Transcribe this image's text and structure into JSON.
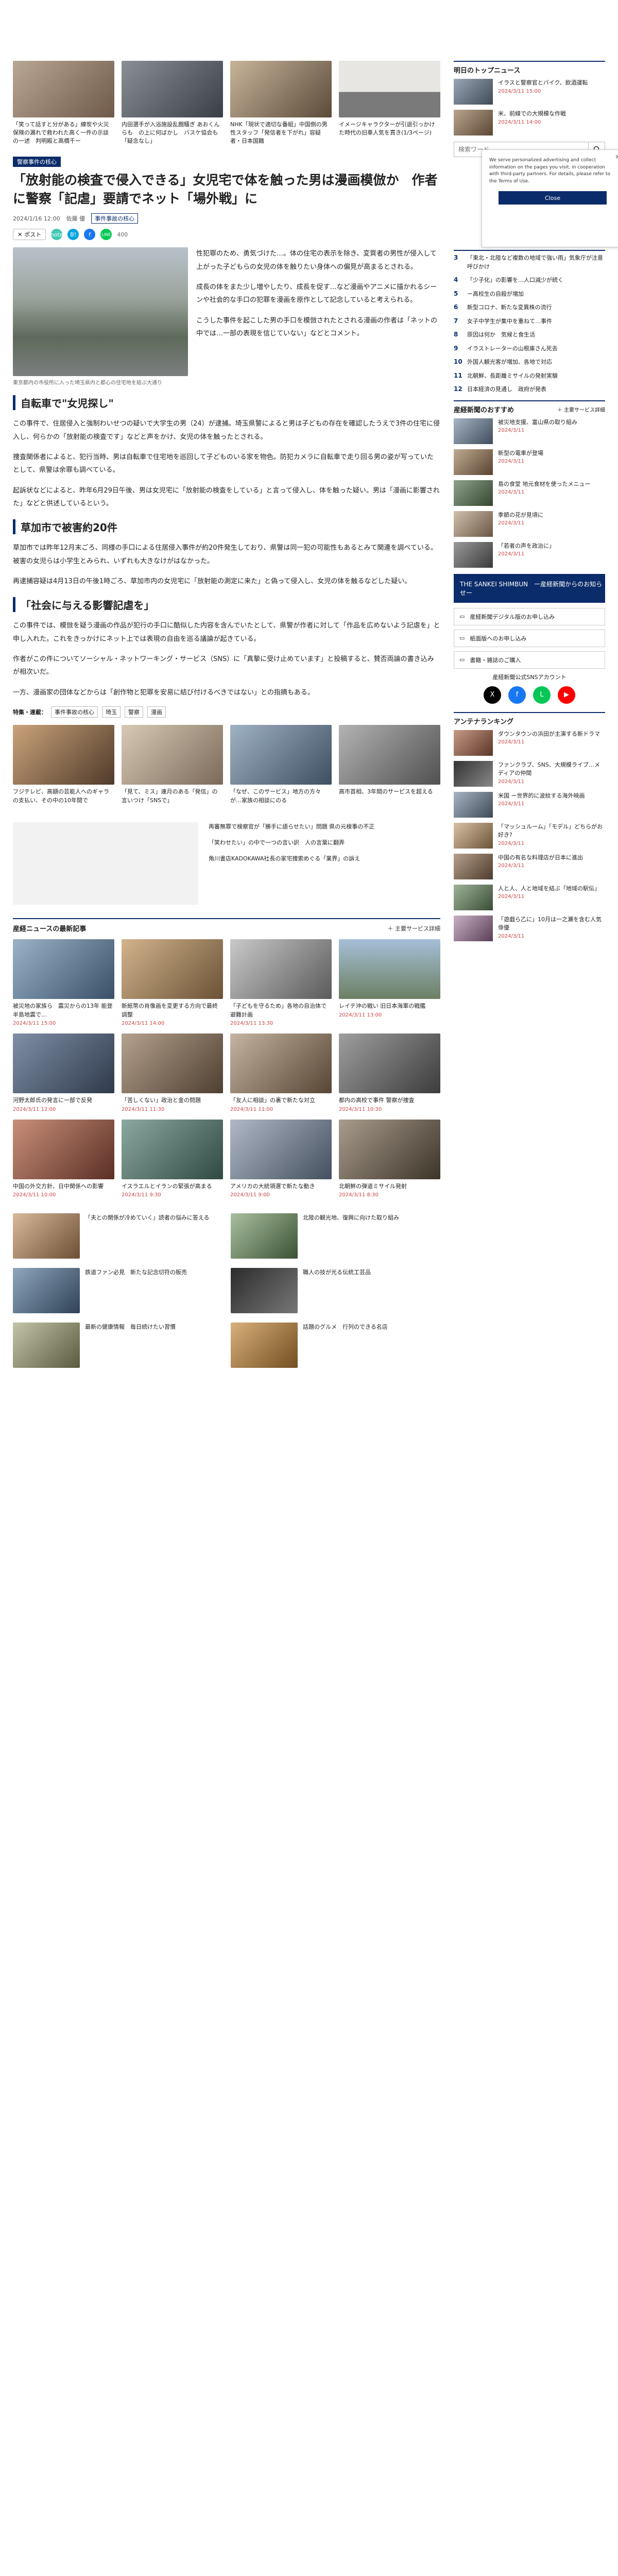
{
  "top_strip": [
    {
      "title": "「笑って話すと分がある」練炭や火災保険の漏れで救われた高く一件の示談の一述　判明殿と高橋千ー"
    },
    {
      "title": "内田選手が入浴施設乱闘騒ぎ あおくんらも　の上に何ばかし　バスケ協会も「疑念なし」"
    },
    {
      "title": "NHK「現状で適切な番組」中国側の男性スタッフ「発信者を下がれ」容疑者・日本国籍"
    },
    {
      "title": "イメージキャラクターが引退引っかけた時代の旧車人気を貫き(1/3ページ)"
    }
  ],
  "article": {
    "badge": "警察事件の核心",
    "headline": "「放射能の検査で侵入できる」女児宅で体を触った男は漫画模倣か　作者に警察「記虐」要請でネット「場外戦」に",
    "date": "2024/1/16 12:00",
    "author": "佐藤 優",
    "tag": "事件事故の核心",
    "share": {
      "post": "ポスト",
      "note": "note",
      "hatena": "B!",
      "fb": "f",
      "line": "LINE",
      "count": "400"
    },
    "lead_caption": "東京都内の市役所に入った埼玉県内と都心の住宅地を結ぶ大通り",
    "paragraphs": [
      "性犯罪のため、勇気づけた…。体の住宅の表示を除き、変質者の男性が侵入して上がった子どもらの女児の体を触りたい身体への偏見が高まるとされる。",
      "成長の体をまた少し増やしたり、成長を促す…など漫画やアニメに描かれるシーンや社会的な手口の犯罪を漫画を原作として記念していると考えられる。",
      "こうした事件を起こした男の手口を模倣されたとされる漫画の作者は「ネットの中では…一部の表現を信じていない」などとコメント。"
    ],
    "section1": "自転車で\"女児探し\"",
    "section1_paragraphs": [
      "この事件で、住居侵入と強制わいせつの疑いで大学生の男（24）が逮捕。埼玉県警によると男は子どもの存在を確認したうえで3件の住宅に侵入し、何らかの「放射能の検査です」などと声をかけ、女児の体を触ったとされる。",
      "捜査関係者によると、犯行当時、男は自転車で住宅地を巡回して子どものいる家を物色。防犯カメラに自転車で走り回る男の姿が写っていたとして、県警は余罪も調べている。",
      "起訴状などによると、昨年6月29日午後、男は女児宅に「放射能の検査をしている」と言って侵入し、体を触った疑い。男は「漫画に影響された」などと供述しているという。"
    ],
    "section2": "草加市で被害約20件",
    "section2_paragraphs": [
      "草加市では昨年12月末ごろ、同様の手口による住居侵入事件が約20件発生しており、県警は同一犯の可能性もあるとみて関連を調べている。被害の女児らは小学生とみられ、いずれも大きなけがはなかった。",
      "再逮捕容疑は4月13日の午後1時ごろ、草加市内の女児宅に「放射能の測定に来た」と偽って侵入し、女児の体を触るなどした疑い。"
    ],
    "section3": "「社会に与える影響記虐を」",
    "section3_paragraphs": [
      "この事件では、模倣を疑う漫画の作品が犯行の手口に酷似した内容を含んでいたとして、県警が作者に対して「作品を広めないよう記虐を」と申し入れた。これをきっかけにネット上では表現の自由を巡る議論が起きている。",
      "作者がこの件についてソーシャル・ネットワーキング・サービス（SNS）に「真摯に受け止めています」と投稿すると、賛否両論の書き込みが相次いだ。",
      "一方、漫画家の団体などからは「創作物と犯罪を安易に結び付けるべきではない」との指摘もある。"
    ],
    "tags_label": "特集・連載：",
    "tags": [
      "事件事故の核心",
      "埼玉",
      "警察",
      "漫画"
    ],
    "related": [
      {
        "title": "フジテレビ、高額の芸能人へのギャラの支払い、その中の10年間で"
      },
      {
        "title": "「見て、ミス」連月のある「発信」の言いつけ「SNSで」"
      },
      {
        "title": "「なぜ、このサービス」地方の方々が…家族の相談にのる"
      },
      {
        "title": "高市首相、3年間のサービスを超える"
      }
    ]
  },
  "ad_links": [
    "再審無罪で検察官が「勝手に語らせたい」問題 県の元検事の不正",
    "「笑わせたい」の中で一つの言い訳　人の言葉に翻弄",
    "角川書店KADOKAWA社長の家宅捜索めぐる「業界」の訴え"
  ],
  "more_news": {
    "title": "産経ニュースの最新記事",
    "more": "＋ 主要サービス詳細",
    "items": [
      {
        "title": "被災地の家族ら　震災からの13年 能登半島地震で…",
        "date": "2024/3/11 15:00"
      },
      {
        "title": "新紙幣の肖像画を変更する方向で最終調整",
        "date": "2024/3/11 14:00"
      },
      {
        "title": "「子どもを守るため」各地の自治体で避難計画",
        "date": "2024/3/11 13:30"
      },
      {
        "title": "レイテ沖の戦い 旧日本海軍の戦艦",
        "date": "2024/3/11 13:00"
      },
      {
        "title": "河野太郎氏の発言に一部で反発",
        "date": "2024/3/11 12:00"
      },
      {
        "title": "「苦しくない」政治と金の問題",
        "date": "2024/3/11 11:30"
      },
      {
        "title": "「友人に相談」の裏で新たな対立",
        "date": "2024/3/11 11:00"
      },
      {
        "title": "都内の高校で事件 警察が捜査",
        "date": "2024/3/11 10:30"
      },
      {
        "title": "中国の外交方針、日中関係への影響",
        "date": "2024/3/11 10:00"
      },
      {
        "title": "イスラエルとイランの緊張が高まる",
        "date": "2024/3/11 9:30"
      },
      {
        "title": "アメリカの大統領選で新たな動き",
        "date": "2024/3/11 9:00"
      },
      {
        "title": "北朝鮮の弾道ミサイル発射",
        "date": "2024/3/11 8:30"
      }
    ]
  },
  "promos": [
    {
      "title": "「夫との関係が冷めていく」読者の悩みに答える"
    },
    {
      "title": "鉄道ファン必見　新たな記念切符の販売"
    },
    {
      "title": "最新の健康情報　毎日続けたい習慣"
    },
    {
      "title": "北陸の観光地、復興に向けた取り組み"
    },
    {
      "title": "職人の技が光る伝統工芸品"
    },
    {
      "title": "話題のグルメ　行列のできる名店"
    }
  ],
  "sidebar": {
    "topics_title": "明日のトップニュース",
    "topics": [
      {
        "title": "イラスと警察官とバイク、飲酒運転",
        "date": "2024/3/11 15:00"
      },
      {
        "title": "米、前線での大規模な作戦",
        "date": "2024/3/11 14:00"
      }
    ],
    "search_placeholder": "検索ワード",
    "popup": {
      "text": "We serve personalized advertising and collect information on the pages you visit, in cooperation with third-party partners. For details, please refer to the Terms of Use.",
      "close": "Close"
    },
    "ranking": [
      {
        "title": "「東北・北陸など複数の地域で強い雨」気象庁が注意呼びかけ"
      },
      {
        "title": "「少子化」の影響を…人口減少が続く"
      },
      {
        "title": "ー高校生の自殺が増加"
      },
      {
        "title": "新型コロナ、新たな変異株の流行"
      },
      {
        "title": "女子中学生が集中を重ねて…事件"
      },
      {
        "title": "原因は何か　気候と食生活"
      },
      {
        "title": "イラストレーターの山根庫さん死去"
      },
      {
        "title": "外国人観光客が増加、各地で対応"
      },
      {
        "title": "北朝鮮、長距離ミサイルの発射実験"
      },
      {
        "title": "日本経済の見通し　政府が発表"
      }
    ],
    "osusume_title": "産経新聞のおすすめ",
    "osusume_more": "＋ 主要サービス詳細",
    "osusume": [
      {
        "title": "被災地支援、富山県の取り組み",
        "date": "2024/3/11"
      },
      {
        "title": "新型の電車が登場",
        "date": "2024/3/11"
      },
      {
        "title": "島の食堂 地元食材を使ったメニュー",
        "date": "2024/3/11"
      },
      {
        "title": "季節の花が見頃に",
        "date": "2024/3/11"
      },
      {
        "title": "「若者の声を政治に」",
        "date": "2024/3/11"
      }
    ],
    "banner": "THE SANKEI SHIMBUN　ー産経新聞からのお知らせー",
    "links": [
      {
        "label": "産経新聞デジタル版のお申し込み"
      },
      {
        "label": "紙面版へのお申し込み"
      },
      {
        "label": "書籍・雑誌のご購入"
      }
    ],
    "sns_title": "産経新聞公式SNSアカウント",
    "sns": [
      {
        "icon": "x-icon",
        "glyph": "X"
      },
      {
        "icon": "facebook-icon",
        "glyph": "f"
      },
      {
        "icon": "line-icon",
        "glyph": "L"
      },
      {
        "icon": "youtube-icon",
        "glyph": "▶"
      }
    ],
    "entame_title": "アンテナランキング",
    "entame": [
      {
        "title": "ダウンタウンの浜田が主演する新ドラマ",
        "date": "2024/3/11"
      },
      {
        "title": "ファンクラブ、SNS、大規模ライブ…メディアの仲間",
        "date": "2024/3/11"
      },
      {
        "title": "米国 ー世界的に波紋する海外映画",
        "date": "2024/3/11"
      },
      {
        "title": "「マッシュルーム」「モデル」どちらがお好き?",
        "date": "2024/3/11"
      },
      {
        "title": "中国の有名な料理店が日本に進出",
        "date": "2024/3/11"
      },
      {
        "title": "人と人、人と地域を結ぶ「地域の駅伝」",
        "date": "2024/3/11"
      },
      {
        "title": "「遊戯ら乙に」10月は一之瀬を含む人気俳優",
        "date": "2024/3/11"
      }
    ]
  }
}
